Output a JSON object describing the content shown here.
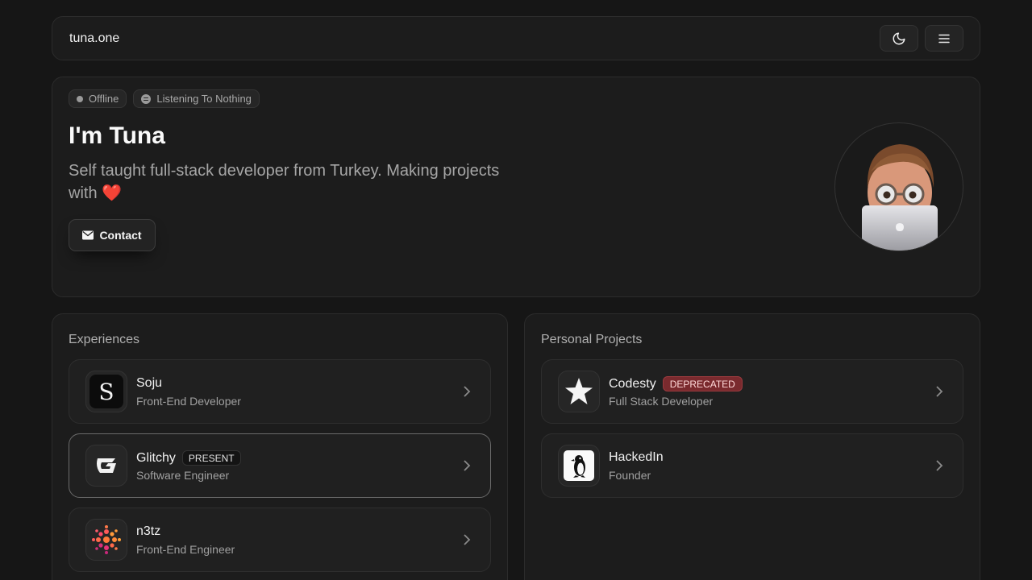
{
  "header": {
    "brand": "tuna.one",
    "theme_icon": "moon-icon",
    "menu_icon": "hamburger-icon"
  },
  "hero": {
    "status": "Offline",
    "spotify": "Listening To Nothing",
    "title": "I'm Tuna",
    "subtitle": "Self taught full-stack developer from Turkey. Making projects with",
    "heart": "❤️",
    "contact_label": "Contact"
  },
  "experiences": {
    "title": "Experiences",
    "items": [
      {
        "name": "Soju",
        "role": "Front-End Developer",
        "tag": ""
      },
      {
        "name": "Glitchy",
        "role": "Software Engineer",
        "tag": "PRESENT"
      },
      {
        "name": "n3tz",
        "role": "Front-End Engineer",
        "tag": ""
      }
    ]
  },
  "projects": {
    "title": "Personal Projects",
    "items": [
      {
        "name": "Codesty",
        "role": "Full Stack Developer",
        "tag": "DEPRECATED"
      },
      {
        "name": "HackedIn",
        "role": "Founder",
        "tag": ""
      }
    ]
  },
  "colors": {
    "background": "#161616",
    "card": "#1c1c1c",
    "deprecated": "#7a2a2e",
    "heart": "#e0334a"
  }
}
